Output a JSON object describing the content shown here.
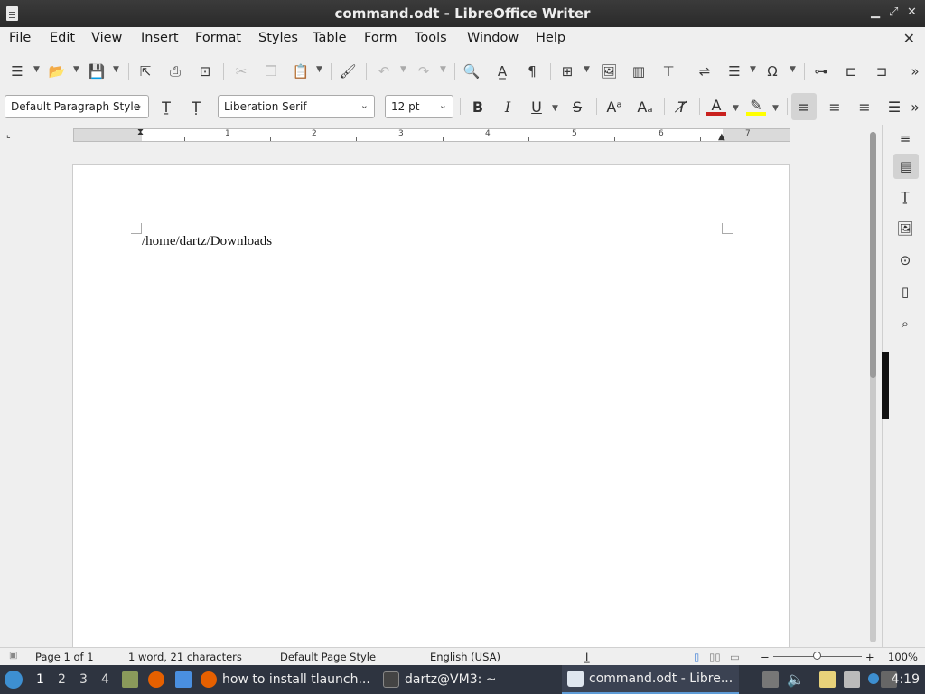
{
  "window": {
    "title": "command.odt - LibreOffice Writer"
  },
  "menu": {
    "items": [
      "File",
      "Edit",
      "View",
      "Insert",
      "Format",
      "Styles",
      "Table",
      "Form",
      "Tools",
      "Window",
      "Help"
    ]
  },
  "formatting": {
    "paragraph_style": "Default Paragraph Style",
    "font_name": "Liberation Serif",
    "font_size": "12 pt"
  },
  "ruler": {
    "numbers": [
      "1",
      "2",
      "3",
      "4",
      "5",
      "6",
      "7"
    ]
  },
  "document": {
    "text": "/home/dartz/Downloads"
  },
  "status": {
    "page": "Page 1 of 1",
    "words": "1 word, 21 characters",
    "page_style": "Default Page Style",
    "language": "English (USA)",
    "zoom": "100%"
  },
  "taskbar": {
    "workspaces": [
      "1",
      "2",
      "3",
      "4"
    ],
    "tasks": [
      "how to install tlaunch...",
      "dartz@VM3: ~",
      "command.odt - Libre..."
    ],
    "clock": "4:19"
  },
  "colors": {
    "font_color": "#c9211e",
    "highlight": "#ffff00",
    "accent": "#5e9bd6"
  }
}
